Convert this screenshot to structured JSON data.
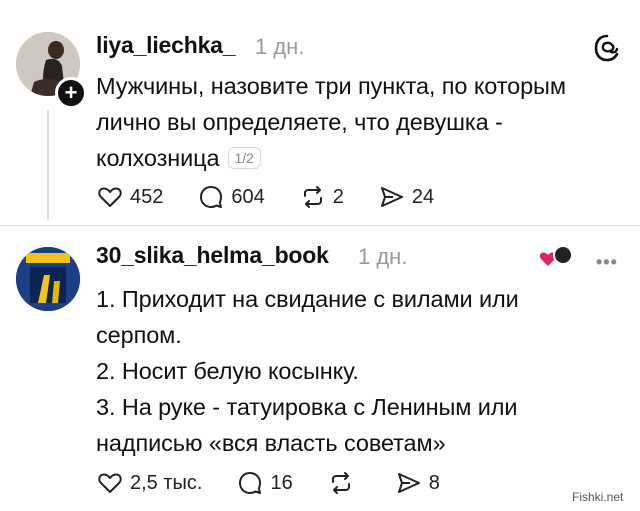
{
  "post": {
    "username": "liya_liechka_",
    "time": "1 дн.",
    "text_line1": "Мужчины, назовите три пункта, по которым",
    "text_line2": "лично вы определяете, что девушка -",
    "text_line3": "колхозница",
    "page_indicator": "1/2",
    "likes": "452",
    "comments": "604",
    "reposts": "2",
    "shares": "24",
    "follow_badge": "+",
    "app_logo_icon": "threads-logo-icon"
  },
  "reply": {
    "username": "30_slika_helma_book",
    "time": "1 дн.",
    "line1": "1. Приходит на свидание с вилами или",
    "line2": "серпом.",
    "line3": "2. Носит белую косынку.",
    "line4": "3. На руке - татуировка с Лениным или",
    "line5": "надписью «вся власть советам»",
    "likes": "2,5 тыс.",
    "comments": "16",
    "reposts": "",
    "shares": "8",
    "more_label": "•••"
  },
  "watermark": "Fishki.net",
  "colors": {
    "text": "#111111",
    "muted": "#9a9a9a",
    "divider": "#e4e4e4",
    "heart_red": "#e0245e"
  }
}
